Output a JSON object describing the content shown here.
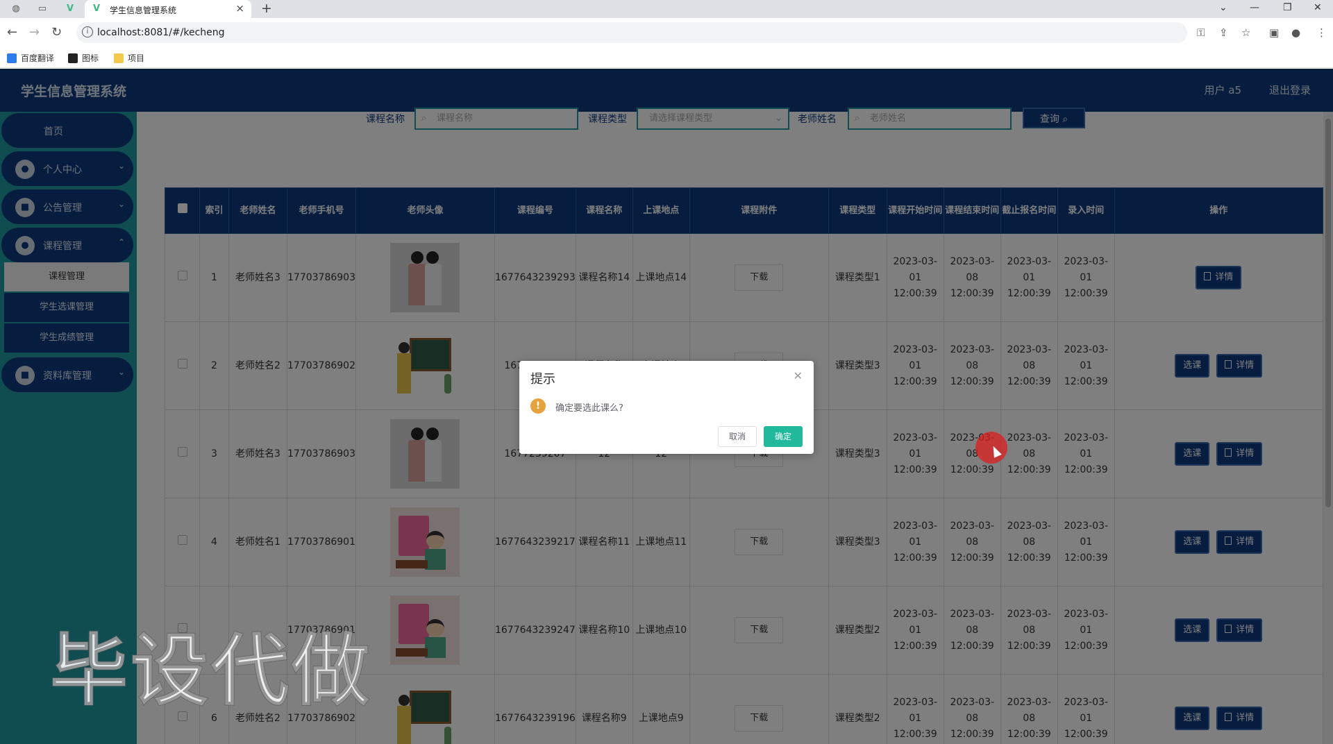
{
  "browser": {
    "tab_title": "学生信息管理系统",
    "url": "localhost:8081/#/kecheng",
    "bookmarks": [
      "百度翻译",
      "图标",
      "项目"
    ]
  },
  "header": {
    "title": "学生信息管理系统",
    "user": "用户 a5",
    "logout": "退出登录"
  },
  "sidebar": {
    "home": "首页",
    "personal": "个人中心",
    "notice": "公告管理",
    "course": "课程管理",
    "sub_items": [
      "课程管理",
      "学生选课管理",
      "学生成绩管理"
    ],
    "resource": "资料库管理"
  },
  "search": {
    "course_name_label": "课程名称",
    "course_name_placeholder": "课程名称",
    "course_type_label": "课程类型",
    "course_type_placeholder": "请选择课程类型",
    "teacher_label": "老师姓名",
    "teacher_placeholder": "老师姓名",
    "query_button": "查询"
  },
  "table": {
    "headers": [
      "索引",
      "老师姓名",
      "老师手机号",
      "老师头像",
      "课程编号",
      "课程名称",
      "上课地点",
      "课程附件",
      "课程类型",
      "课程开始时间",
      "课程结束时间",
      "截止报名时间",
      "录入时间",
      "操作"
    ],
    "download_label": "下载",
    "select_label": "选课",
    "detail_label": "详情",
    "rows": [
      {
        "index": "1",
        "teacher": "老师姓名3",
        "phone": "17703786903",
        "avatar": "photo",
        "code": "1677643239293",
        "name": "课程名称14",
        "place": "上课地点14",
        "type": "课程类型1",
        "start": "2023-03-01 12:00:39",
        "end": "2023-03-08 12:00:39",
        "deadline": "2023-03-01 12:00:39",
        "created": "2023-03-01 12:00:39",
        "can_select": false
      },
      {
        "index": "2",
        "teacher": "老师姓名2",
        "phone": "17703786902",
        "avatar": "board",
        "code": "1677643239",
        "name": "课程名称",
        "place": "上课地点",
        "type": "课程类型3",
        "start": "2023-03-01 12:00:39",
        "end": "2023-03-08 12:00:39",
        "deadline": "2023-03-08 12:00:39",
        "created": "2023-03-01 12:00:39",
        "can_select": true
      },
      {
        "index": "3",
        "teacher": "老师姓名3",
        "phone": "17703786903",
        "avatar": "photo",
        "code": "1677239207",
        "name": "12",
        "place": "12",
        "type": "课程类型3",
        "start": "2023-03-01 12:00:39",
        "end": "2023-03-08 12:00:39",
        "deadline": "2023-03-08 12:00:39",
        "created": "2023-03-01 12:00:39",
        "can_select": true
      },
      {
        "index": "4",
        "teacher": "老师姓名1",
        "phone": "17703786901",
        "avatar": "cartoon",
        "code": "1677643239217",
        "name": "课程名称11",
        "place": "上课地点11",
        "type": "课程类型3",
        "start": "2023-03-01 12:00:39",
        "end": "2023-03-08 12:00:39",
        "deadline": "2023-03-08 12:00:39",
        "created": "2023-03-01 12:00:39",
        "can_select": true
      },
      {
        "index": "",
        "teacher": "",
        "phone": "17703786901",
        "avatar": "cartoon",
        "code": "1677643239247",
        "name": "课程名称10",
        "place": "上课地点10",
        "type": "课程类型2",
        "start": "2023-03-01 12:00:39",
        "end": "2023-03-08 12:00:39",
        "deadline": "2023-03-08 12:00:39",
        "created": "2023-03-01 12:00:39",
        "can_select": true
      },
      {
        "index": "6",
        "teacher": "老师姓名2",
        "phone": "17703786902",
        "avatar": "board",
        "code": "1677643239196",
        "name": "课程名称9",
        "place": "上课地点9",
        "type": "课程类型2",
        "start": "2023-03-01 12:00:39",
        "end": "2023-03-08 12:00:39",
        "deadline": "2023-03-08 12:00:39",
        "created": "2023-03-01 12:00:39",
        "can_select": true
      }
    ]
  },
  "dialog": {
    "title": "提示",
    "message": "确定要选此课么?",
    "cancel": "取消",
    "confirm": "确定"
  },
  "watermark": "毕设代做",
  "colors": {
    "primary": "#0d3a80",
    "sidebar_bg": "#1e9aa3",
    "confirm": "#20b99c",
    "warning": "#e6a23c"
  }
}
